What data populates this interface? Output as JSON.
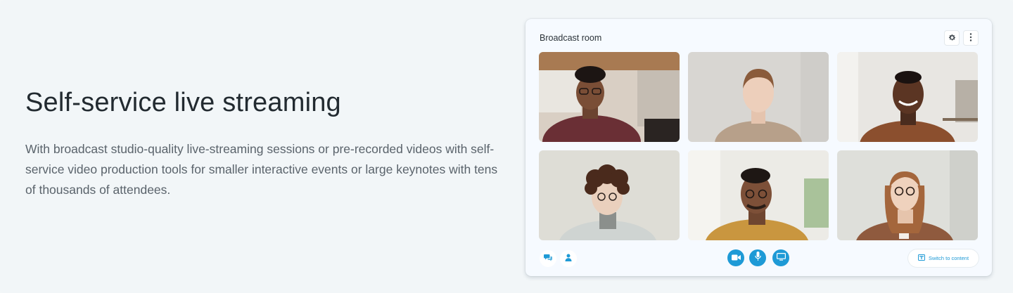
{
  "hero": {
    "title": "Self-service live streaming",
    "body": "With broadcast studio-quality live-streaming sessions or pre-recorded videos with self-service video production tools for smaller interactive events or large keynotes with tens of thousands of attendees."
  },
  "room": {
    "title": "Broadcast room",
    "settings_icon": "gear-icon",
    "more_icon": "kebab-menu-icon",
    "participants": [
      {
        "icon": "participant-1-video"
      },
      {
        "icon": "participant-2-video"
      },
      {
        "icon": "participant-3-video"
      },
      {
        "icon": "participant-4-video"
      },
      {
        "icon": "participant-5-video"
      },
      {
        "icon": "participant-6-video"
      }
    ],
    "controls": {
      "chat_icon": "chat-icon",
      "people_icon": "person-icon",
      "camera_icon": "video-camera-icon",
      "mic_icon": "microphone-icon",
      "screen_icon": "screen-share-icon",
      "switch_label": "Switch to content"
    }
  },
  "colors": {
    "accent": "#1e9ad6",
    "title": "#222a30",
    "body": "#5a636b",
    "background": "#f2f6f8"
  }
}
